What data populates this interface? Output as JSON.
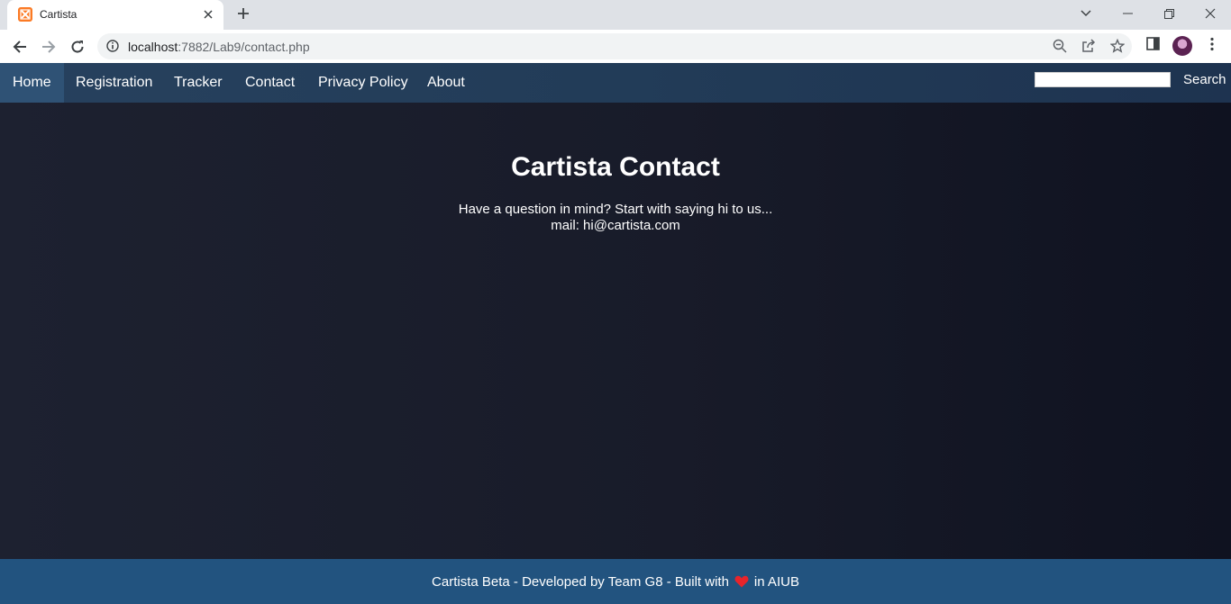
{
  "browser": {
    "tab_title": "Cartista",
    "url_host": "localhost",
    "url_path": ":7882/Lab9/contact.php"
  },
  "nav": {
    "items": [
      "Home",
      "Registration",
      "Tracker",
      "Contact",
      "Privacy Policy",
      "About"
    ],
    "search_label": "Search",
    "search_value": ""
  },
  "content": {
    "heading": "Cartista Contact",
    "line1": "Have a question in mind? Start with saying hi to us...",
    "line2": "mail: hi@cartista.com"
  },
  "footer": {
    "text_before": "Cartista Beta - Developed by Team G8 - Built with",
    "text_after": "in AIUB"
  },
  "colors": {
    "nav_bg": "#223c58",
    "nav_active": "#2f5275",
    "page_bg": "#181b29",
    "footer_bg": "#22537f",
    "heart": "#e8242b",
    "favicon": "#fb7a24"
  },
  "icons": [
    "xampp-favicon-icon",
    "close-icon",
    "plus-icon",
    "chevron-down-icon",
    "minimize-icon",
    "restore-icon",
    "window-close-icon",
    "back-arrow-icon",
    "forward-arrow-icon",
    "reload-icon",
    "info-icon",
    "zoom-icon",
    "share-icon",
    "star-icon",
    "side-panel-icon",
    "menu-dots-icon",
    "heart-icon"
  ]
}
